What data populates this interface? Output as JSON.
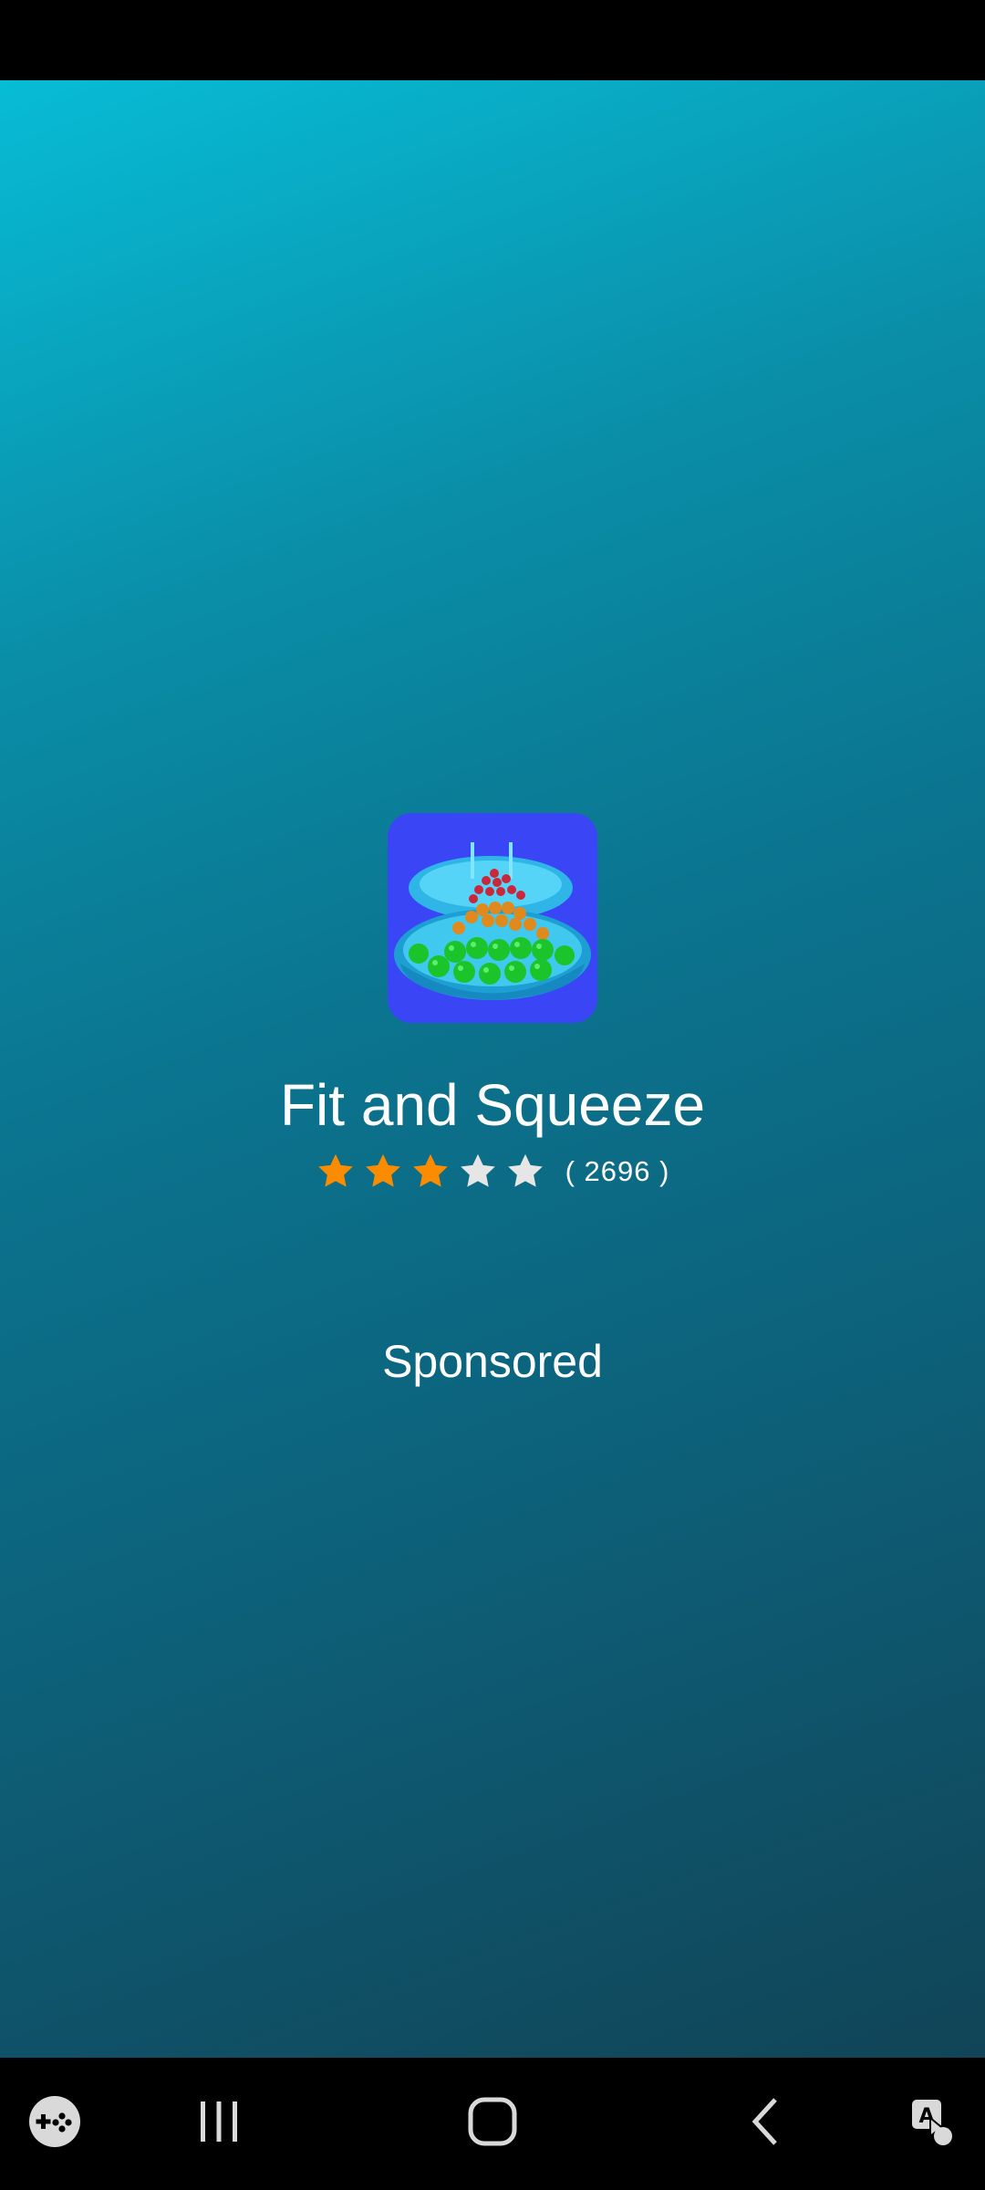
{
  "ad": {
    "app_name": "Fit and Squeeze",
    "rating": 3,
    "rating_max": 5,
    "rating_count": "( 2696 )",
    "sponsored_label": "Sponsored",
    "icon": "app-icon-bowls-with-balls"
  },
  "colors": {
    "star_filled": "#fb8c00",
    "star_empty": "#e6e6e6",
    "icon_background": "#3a46f5"
  },
  "navigation": {
    "game_launcher_icon": "game-controller-icon",
    "recents_icon": "recents-icon",
    "home_icon": "home-icon",
    "back_icon": "back-icon",
    "accessibility_icon": "accessibility-icon"
  }
}
